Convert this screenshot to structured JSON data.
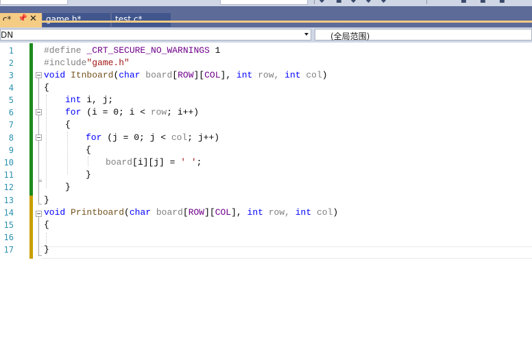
{
  "tabs": [
    {
      "label": ".c*",
      "pin": "📌",
      "close": "✕",
      "active": true
    },
    {
      "label": "game.h*"
    },
    {
      "label": "test.c*"
    }
  ],
  "nav": {
    "left": "DN",
    "right": "(全局范围)"
  },
  "line_numbers": [
    "1",
    "2",
    "3",
    "4",
    "5",
    "6",
    "7",
    "8",
    "9",
    "10",
    "11",
    "12",
    "13",
    "14",
    "15",
    "16",
    "17"
  ],
  "code": {
    "l1": {
      "kw": "#define ",
      "mac": "_CRT_SECURE_NO_WARNINGS",
      "rest": " 1"
    },
    "l2": {
      "kw": "#include",
      "str": "\"game.h\""
    },
    "l3": {
      "kw": "void ",
      "fn": "Itnboard",
      "p1": "(",
      "t1": "char",
      "a1": " board",
      "b1": "[",
      "m1": "ROW",
      "b2": "][",
      "m2": "COL",
      "b3": "], ",
      "t2": "int",
      "a2": " row, ",
      "t3": "int",
      "a3": " col",
      "p2": ")"
    },
    "l4": "{",
    "l5": {
      "kw": "int",
      "rest": " i, j;"
    },
    "l6": {
      "kw": "for",
      "rest": " (i = 0; i < ",
      "par": "row",
      "end": "; i++)"
    },
    "l7": "{",
    "l8": {
      "kw": "for",
      "rest": " (j = 0; j < ",
      "par": "col",
      "end": "; j++)"
    },
    "l9": "{",
    "l10": {
      "par": "board",
      "rest": "[i][j] = ",
      "str": "' '",
      "end": ";"
    },
    "l11": "}",
    "l12": "}",
    "l13": "}",
    "l14": {
      "kw": "void ",
      "fn": "Printboard",
      "p1": "(",
      "t1": "char",
      "a1": " board",
      "b1": "[",
      "m1": "ROW",
      "b2": "][",
      "m2": "COL",
      "b3": "], ",
      "t2": "int",
      "a2": " row, ",
      "t3": "int",
      "a3": " col",
      "p2": ")"
    },
    "l15": "{",
    "l16": "",
    "l17": "}"
  },
  "colors": {
    "tab_active": "#f5cc84",
    "tab_inactive": "#40568d",
    "saved_bar": "#1e8b1e",
    "unsaved_bar": "#c8a000"
  }
}
